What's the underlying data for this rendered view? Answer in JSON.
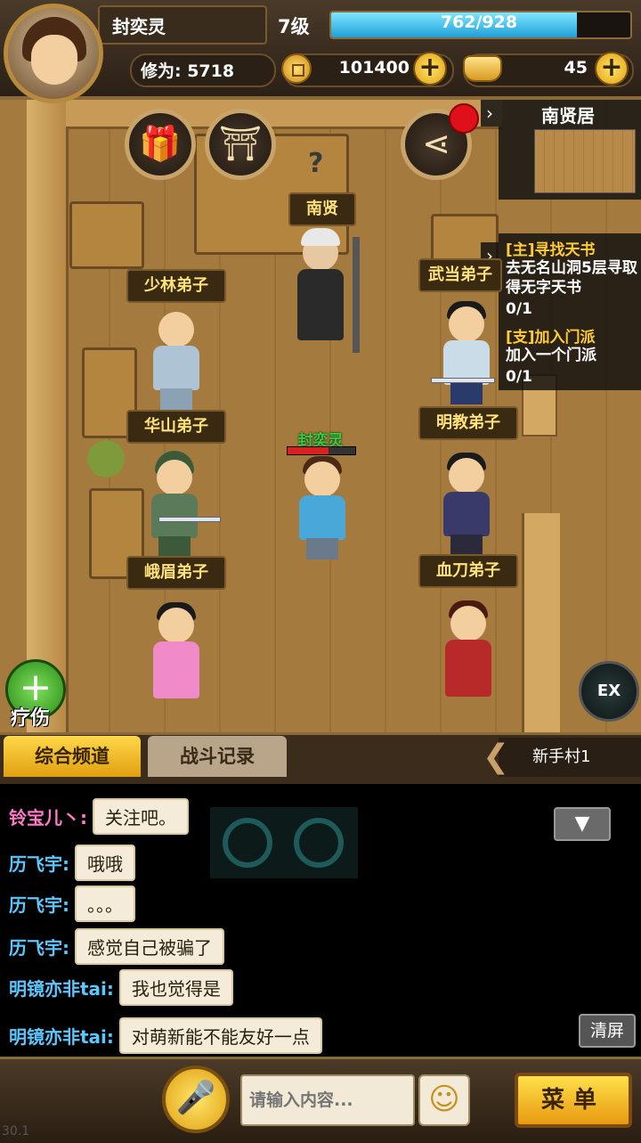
{
  "player": {
    "name": "封奕灵",
    "level": "7级",
    "xp_text": "762/928",
    "xp_fraction": 0.82,
    "cultivation": "修为: 5718",
    "coins": "101400",
    "ingots": "45"
  },
  "minimap": {
    "title": "南贤居"
  },
  "quests": [
    {
      "title": "[主]寻找天书",
      "desc": "去无名山洞5层寻取得无字天书",
      "progress": "0/1"
    },
    {
      "title": "[支]加入门派",
      "desc": "加入一个门派",
      "progress": "0/1"
    }
  ],
  "npcs": {
    "nanxian": "南贤",
    "shaolin": "少林弟子",
    "wudang": "武当弟子",
    "huashan": "华山弟子",
    "mingjiao": "明教弟子",
    "emei": "峨眉弟子",
    "xuedao": "血刀弟子"
  },
  "hero_label": "封奕灵",
  "heal_label": "疗伤",
  "ex_label": "EX",
  "chat": {
    "tabs": [
      "综合频道",
      "战斗记录"
    ],
    "channel": "新手村1",
    "messages": [
      {
        "name": "铃宝儿丶:",
        "text": "关注吧。",
        "color": "#ff7ac8"
      },
      {
        "name": "历飞宇:",
        "text": "哦哦",
        "color": "#5ac8ff"
      },
      {
        "name": "历飞宇:",
        "text": "。。。",
        "color": "#5ac8ff"
      },
      {
        "name": "历飞宇:",
        "text": "感觉自己被骗了",
        "color": "#5ac8ff"
      },
      {
        "name": "明镜亦非tai:",
        "text": "我也觉得是",
        "color": "#5ac8ff"
      },
      {
        "name": "明镜亦非tai:",
        "text": "对萌新能不能友好一点",
        "color": "#5ac8ff"
      }
    ],
    "clear_label": "清屏",
    "input_placeholder": "请输入内容..."
  },
  "menu_label": "菜单",
  "fps": "30.1"
}
